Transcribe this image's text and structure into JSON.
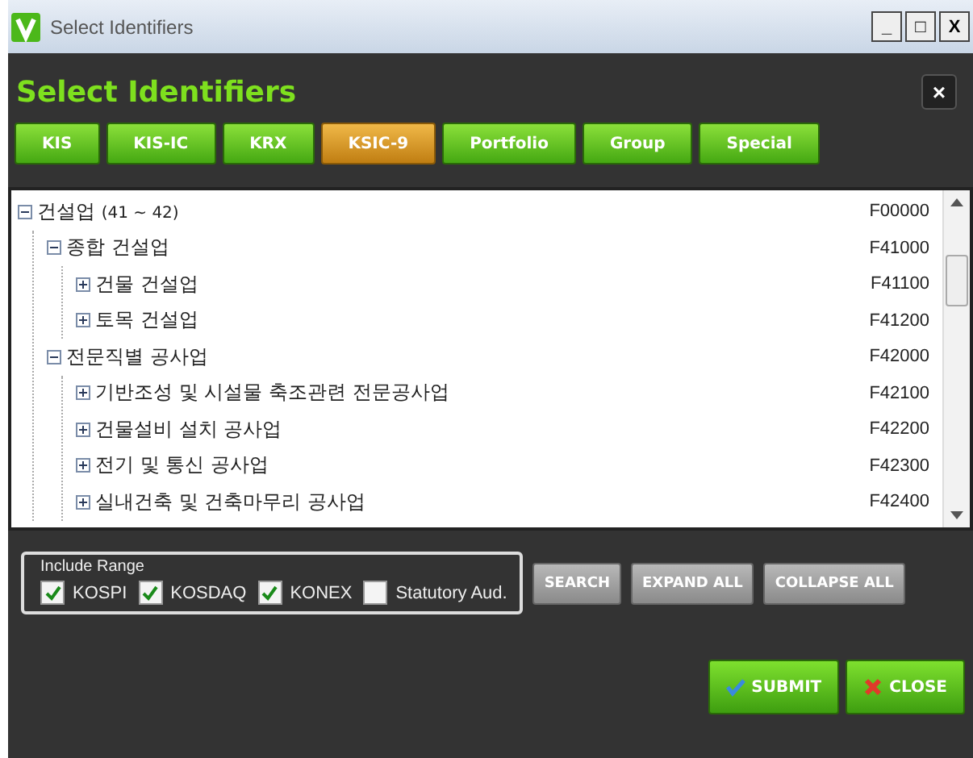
{
  "window": {
    "title": "Select Identifiers",
    "controls": [
      "_",
      "□",
      "X"
    ]
  },
  "header": {
    "title": "Select Identifiers",
    "close": "×"
  },
  "tabs": [
    {
      "label": "KIS",
      "selected": false
    },
    {
      "label": "KIS-IC",
      "selected": false
    },
    {
      "label": "KRX",
      "selected": false
    },
    {
      "label": "KSIC-9",
      "selected": true
    },
    {
      "label": "Portfolio",
      "selected": false
    },
    {
      "label": "Group",
      "selected": false
    },
    {
      "label": "Special",
      "selected": false
    }
  ],
  "tree": [
    {
      "label": "건설업",
      "note": "(41 ~ 42)",
      "code": "F00000",
      "expanded": true,
      "children": [
        {
          "label": "종합 건설업",
          "code": "F41000",
          "expanded": true,
          "children": [
            {
              "label": "건물 건설업",
              "code": "F41100",
              "expanded": false
            },
            {
              "label": "토목 건설업",
              "code": "F41200",
              "expanded": false
            }
          ]
        },
        {
          "label": "전문직별 공사업",
          "code": "F42000",
          "expanded": true,
          "children": [
            {
              "label": "기반조성 및 시설물 축조관련 전문공사업",
              "code": "F42100",
              "expanded": false
            },
            {
              "label": "건물설비 설치 공사업",
              "code": "F42200",
              "expanded": false
            },
            {
              "label": "전기 및 통신 공사업",
              "code": "F42300",
              "expanded": false
            },
            {
              "label": "실내건축 및 건축마무리 공사업",
              "code": "F42400",
              "expanded": false
            }
          ]
        }
      ]
    }
  ],
  "range": {
    "title": "Include Range",
    "options": [
      {
        "label": "KOSPI",
        "checked": true
      },
      {
        "label": "KOSDAQ",
        "checked": true
      },
      {
        "label": "KONEX",
        "checked": true
      },
      {
        "label": "Statutory Aud.",
        "checked": false
      }
    ]
  },
  "actions": [
    "SEARCH",
    "EXPAND ALL",
    "COLLAPSE ALL"
  ],
  "footer": [
    {
      "label": "SUBMIT",
      "kind": "submit"
    },
    {
      "label": "CLOSE",
      "kind": "close"
    }
  ]
}
